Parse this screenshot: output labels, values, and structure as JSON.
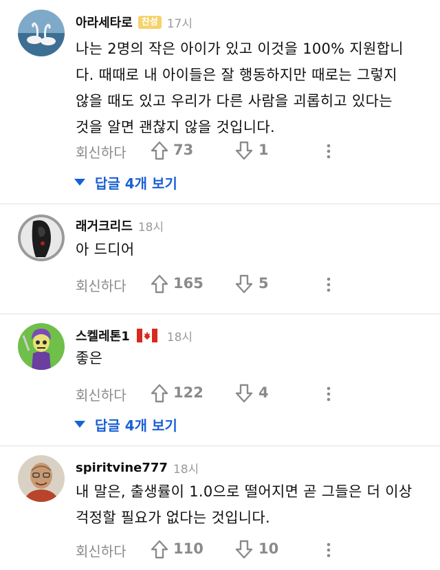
{
  "colors": {
    "accent": "#1a5fd6",
    "badge": "#f5d36b",
    "muted": "#8a8a8a",
    "time": "#9a9a9a"
  },
  "comments": [
    {
      "author": "아라세타로",
      "badge": "찬성",
      "time": "17시",
      "avatar": "swan-avatar",
      "text_lines": [
        "나는 2명의 작은 아이가 있고 이것을 100% 지원합니",
        "다. 때때로 내 아이들은 잘 행동하지만 때로는 그렇지",
        "않을 때도 있고 우리가 다른 사람을 괴롭히고 있다는",
        "것을 알면 괜찮지 않을 것입니다."
      ],
      "reply_label": "회신하다",
      "upvotes": "73",
      "downvotes": "1",
      "view_replies": "답글 4개 보기"
    },
    {
      "author": "래거크리드",
      "time": "18시",
      "avatar": "dark-figure-avatar",
      "text_lines": [
        "아 드디어"
      ],
      "reply_label": "회신하다",
      "upvotes": "165",
      "downvotes": "5"
    },
    {
      "author": "스켈레톤1",
      "flag": "canada-flag-icon",
      "time": "18시",
      "avatar": "skeletor-avatar",
      "text_lines": [
        "좋은"
      ],
      "reply_label": "회신하다",
      "upvotes": "122",
      "downvotes": "4",
      "view_replies": "답글 4개 보기"
    },
    {
      "author": "spiritvine777",
      "time": "18시",
      "avatar": "monk-avatar",
      "text_lines": [
        "내 말은, 출생률이 1.0으로 떨어지면 곧 그들은 더 이상",
        "걱정할 필요가 없다는 것입니다."
      ],
      "reply_label": "회신하다",
      "upvotes": "110",
      "downvotes": "10"
    }
  ]
}
